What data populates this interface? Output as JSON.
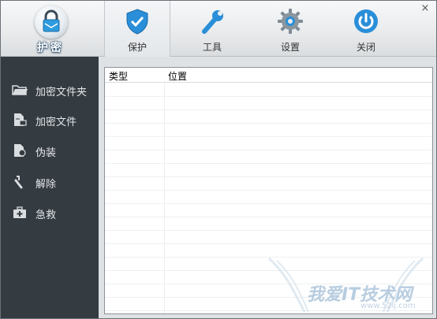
{
  "app": {
    "logo_label": "护密",
    "close_glyph": "×"
  },
  "toolbar": {
    "items": [
      {
        "label": "保护",
        "icon": "shield-icon",
        "active": true
      },
      {
        "label": "工具",
        "icon": "wrench-icon",
        "active": false
      },
      {
        "label": "设置",
        "icon": "gear-icon",
        "active": false
      },
      {
        "label": "关闭",
        "icon": "power-icon",
        "active": false
      }
    ]
  },
  "sidebar": {
    "items": [
      {
        "label": "加密文件夹",
        "icon": "folder-icon"
      },
      {
        "label": "加密文件",
        "icon": "file-icon"
      },
      {
        "label": "伪装",
        "icon": "disguise-icon"
      },
      {
        "label": "解除",
        "icon": "unlock-icon"
      },
      {
        "label": "急救",
        "icon": "first-aid-icon"
      }
    ]
  },
  "list": {
    "columns": [
      "类型",
      "位置"
    ],
    "rows": []
  },
  "watermark": {
    "text": "我爱IT技术网",
    "url": "www.52ij.com"
  },
  "colors": {
    "sidebar_bg": "#343b41",
    "accent_blue": "#2d8bd6"
  }
}
